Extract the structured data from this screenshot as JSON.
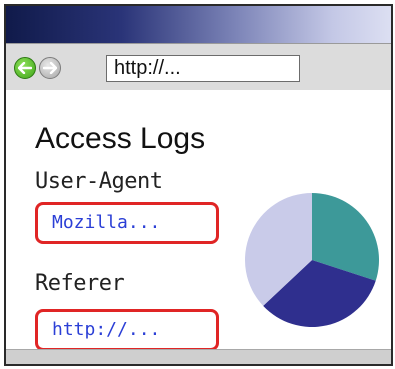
{
  "browser": {
    "address": "http://..."
  },
  "page": {
    "title": "Access Logs",
    "user_agent_label": "User-Agent",
    "user_agent_value": "Mozilla...",
    "referer_label": "Referer",
    "referer_value": "http://..."
  },
  "icons": {
    "back": "back-arrow-icon",
    "forward": "forward-arrow-icon"
  },
  "colors": {
    "back_button": "#3ea518",
    "field_border": "#e02525",
    "field_text": "#2b3fd6"
  },
  "chart_data": {
    "type": "pie",
    "slices": [
      {
        "value": 30,
        "color": "#3d9999"
      },
      {
        "value": 33,
        "color": "#2f2f8e"
      },
      {
        "value": 37,
        "color": "#c9cbe9"
      }
    ]
  }
}
